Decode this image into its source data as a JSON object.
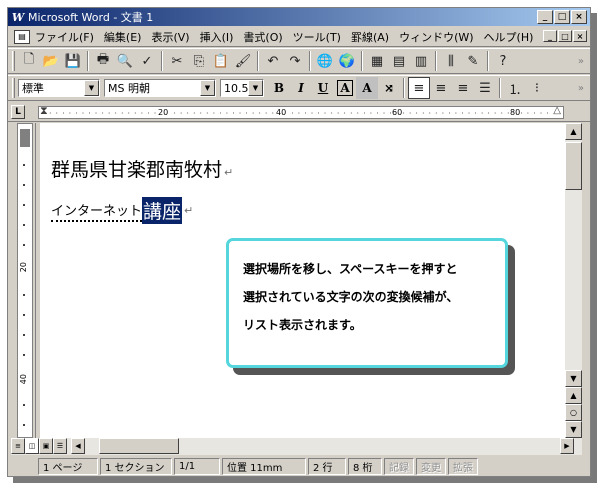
{
  "window": {
    "app_icon": "W",
    "title": "Microsoft Word - 文書 1",
    "min": "_",
    "max": "□",
    "close": "×"
  },
  "menu": {
    "items": [
      "ファイル(F)",
      "編集(E)",
      "表示(V)",
      "挿入(I)",
      "書式(O)",
      "ツール(T)",
      "罫線(A)",
      "ウィンドウ(W)",
      "ヘルプ(H)"
    ],
    "win_min": "_",
    "win_max": "□",
    "win_close": "×"
  },
  "toolbar_standard": {
    "icons": [
      "new-doc",
      "open",
      "save",
      "print",
      "print-preview",
      "spelling",
      "cut",
      "copy",
      "paste",
      "format-painter",
      "undo",
      "redo",
      "hyperlink",
      "web-toolbar",
      "tables-borders",
      "insert-table",
      "insert-excel",
      "columns",
      "drawing",
      "help"
    ]
  },
  "toolbar_format": {
    "style": "標準",
    "font": "MS 明朝",
    "size": "10.5",
    "bold": "B",
    "italic": "I",
    "underline": "U",
    "char_border": "A",
    "char_shading": "A"
  },
  "ruler": {
    "marks": [
      "20",
      "40",
      "60",
      "80"
    ]
  },
  "vruler": {
    "marks": [
      "20",
      "40"
    ]
  },
  "document": {
    "line1": "群馬県甘楽郡南牧村",
    "line2_prefix": "インターネット",
    "line2_selected": "講座",
    "para_mark": "↵"
  },
  "callout": {
    "text_lines": [
      "選択場所を移し、スペースキーを押すと",
      "選択されている文字の次の変換候補が、",
      "リスト表示されます。"
    ]
  },
  "status": {
    "page": "1 ページ",
    "section": "1 セクション",
    "page_of": "1/1",
    "position": "位置 11mm",
    "line": "2 行",
    "column": "8 桁",
    "rec": "記録",
    "trk": "変更",
    "ext": "拡張"
  }
}
